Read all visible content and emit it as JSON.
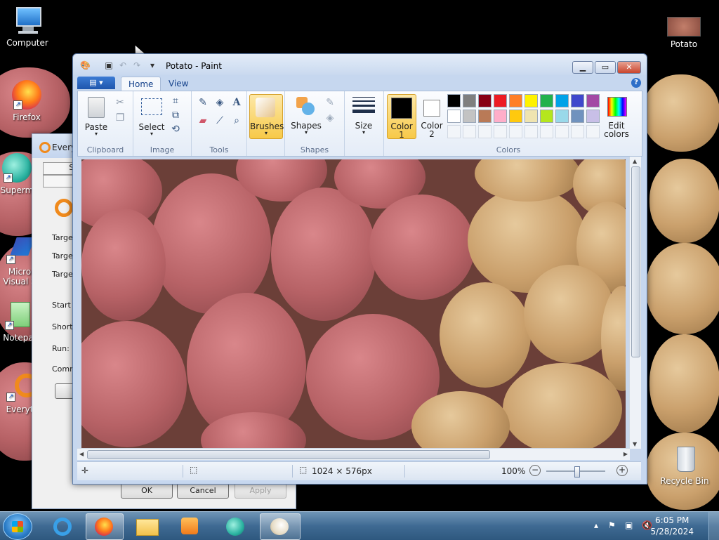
{
  "desktop": {
    "icons": [
      {
        "label": "Computer"
      },
      {
        "label": "Potato"
      },
      {
        "label": "Firefox"
      },
      {
        "label": "Superm"
      },
      {
        "label": "Micro"
      },
      {
        "label": "Visual S"
      },
      {
        "label": "Notepa"
      },
      {
        "label": "Everyt"
      },
      {
        "label": "Recycle Bin"
      }
    ]
  },
  "props_dialog": {
    "title": "Every",
    "tabs": [
      "Se",
      "G"
    ],
    "labels": [
      "Target",
      "Target",
      "Target",
      "Start i",
      "Shortc",
      "Run:",
      "Comm"
    ],
    "buttons": {
      "open": "Op",
      "ok": "OK",
      "cancel": "Cancel",
      "apply": "Apply"
    }
  },
  "paint": {
    "title": "Potato - Paint",
    "tabs": {
      "home": "Home",
      "view": "View"
    },
    "groups": {
      "clipboard": "Clipboard",
      "image": "Image",
      "tools": "Tools",
      "shapes": "Shapes",
      "colors": "Colors"
    },
    "buttons": {
      "paste": "Paste",
      "select": "Select",
      "brushes": "Brushes",
      "shapes": "Shapes",
      "size": "Size",
      "color1": "Color",
      "color1_num": "1",
      "color2": "Color",
      "color2_num": "2",
      "edit_colors_1": "Edit",
      "edit_colors_2": "colors"
    },
    "palette_row1": [
      "#000000",
      "#7f7f7f",
      "#880015",
      "#ed1c24",
      "#ff7f27",
      "#fff200",
      "#22b14c",
      "#00a2e8",
      "#3f48cc",
      "#a349a4"
    ],
    "palette_row2": [
      "#ffffff",
      "#c3c3c3",
      "#b97a57",
      "#ffaec9",
      "#ffc90e",
      "#efe4b0",
      "#b5e61d",
      "#99d9ea",
      "#7092be",
      "#c8bfe7"
    ],
    "status": {
      "image_size": "1024 × 576px",
      "zoom": "100%"
    }
  },
  "taskbar": {
    "time": "6:05 PM",
    "date": "5/28/2024"
  }
}
